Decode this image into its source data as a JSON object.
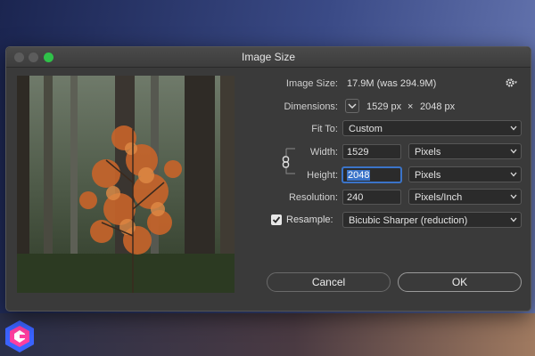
{
  "dialog": {
    "title": "Image Size",
    "image_size_label": "Image Size:",
    "image_size_value": "17.9M (was 294.9M)",
    "dimensions_label": "Dimensions:",
    "dimensions_width": "1529 px",
    "dimensions_times": "×",
    "dimensions_height": "2048 px",
    "fit_to_label": "Fit To:",
    "fit_to_value": "Custom",
    "width_label": "Width:",
    "width_value": "1529",
    "width_unit": "Pixels",
    "height_label": "Height:",
    "height_value": "2048",
    "height_unit": "Pixels",
    "resolution_label": "Resolution:",
    "resolution_value": "240",
    "resolution_unit": "Pixels/Inch",
    "resample_label": "Resample:",
    "resample_checked": true,
    "resample_value": "Bicubic Sharper (reduction)",
    "cancel_label": "Cancel",
    "ok_label": "OK"
  },
  "icons": {
    "gear": "gear-icon",
    "chain": "chain-link-icon",
    "chevron": "chevron-down-icon",
    "check": "checkmark-icon"
  },
  "colors": {
    "dialog_bg": "#3a3a3a",
    "field_bg": "#2b2b2b",
    "focus_blue": "#3b74c9",
    "zoom_green": "#2fc149"
  }
}
